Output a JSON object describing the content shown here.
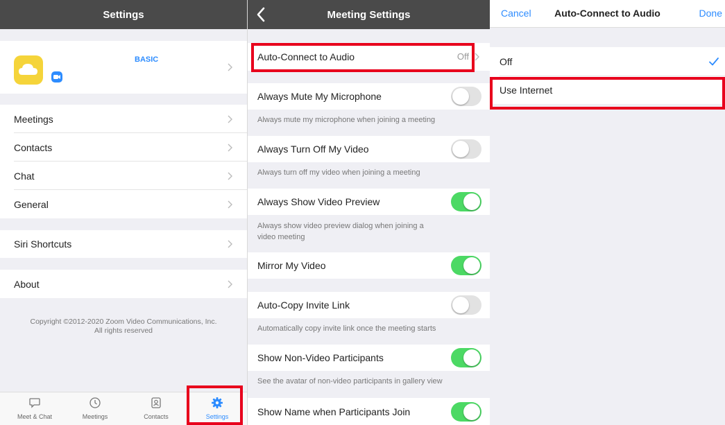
{
  "settings": {
    "title": "Settings",
    "profile": {
      "plan": "BASIC"
    },
    "items": [
      {
        "label": "Meetings"
      },
      {
        "label": "Contacts"
      },
      {
        "label": "Chat"
      },
      {
        "label": "General"
      },
      {
        "label": "Siri Shortcuts"
      },
      {
        "label": "About"
      }
    ],
    "copyright_line1": "Copyright ©2012-2020 Zoom Video Communications, Inc.",
    "copyright_line2": "All rights reserved",
    "tabs": [
      {
        "label": "Meet & Chat",
        "icon": "chat-bubble-icon"
      },
      {
        "label": "Meetings",
        "icon": "clock-icon"
      },
      {
        "label": "Contacts",
        "icon": "contacts-icon"
      },
      {
        "label": "Settings",
        "icon": "gear-icon",
        "active": true
      }
    ]
  },
  "meeting_settings": {
    "title": "Meeting Settings",
    "auto_connect": {
      "label": "Auto-Connect to Audio",
      "value": "Off"
    },
    "options": [
      {
        "label": "Always Mute My Microphone",
        "hint": "Always mute my microphone when joining a meeting",
        "on": false
      },
      {
        "label": "Always Turn Off My Video",
        "hint": "Always turn off my video when joining a meeting",
        "on": false
      },
      {
        "label": "Always Show Video Preview",
        "hint": "Always show video preview dialog when joining a video meeting",
        "on": true
      },
      {
        "label": "Mirror My Video",
        "on": true
      },
      {
        "label": "Auto-Copy Invite Link",
        "hint": "Automatically copy invite link once the meeting starts",
        "on": false
      },
      {
        "label": "Show Non-Video Participants",
        "hint": "See the avatar of non-video participants in gallery view",
        "on": true
      },
      {
        "label": "Show Name when Participants Join",
        "on": true
      }
    ]
  },
  "audio_picker": {
    "cancel": "Cancel",
    "title": "Auto-Connect to Audio",
    "done": "Done",
    "options": [
      {
        "label": "Off",
        "selected": true
      },
      {
        "label": "Use Internet",
        "selected": false
      }
    ]
  },
  "colors": {
    "accent": "#2d8cff",
    "toggle_on": "#4cd964",
    "highlight": "#e8001c",
    "header": "#4a4a4a"
  }
}
